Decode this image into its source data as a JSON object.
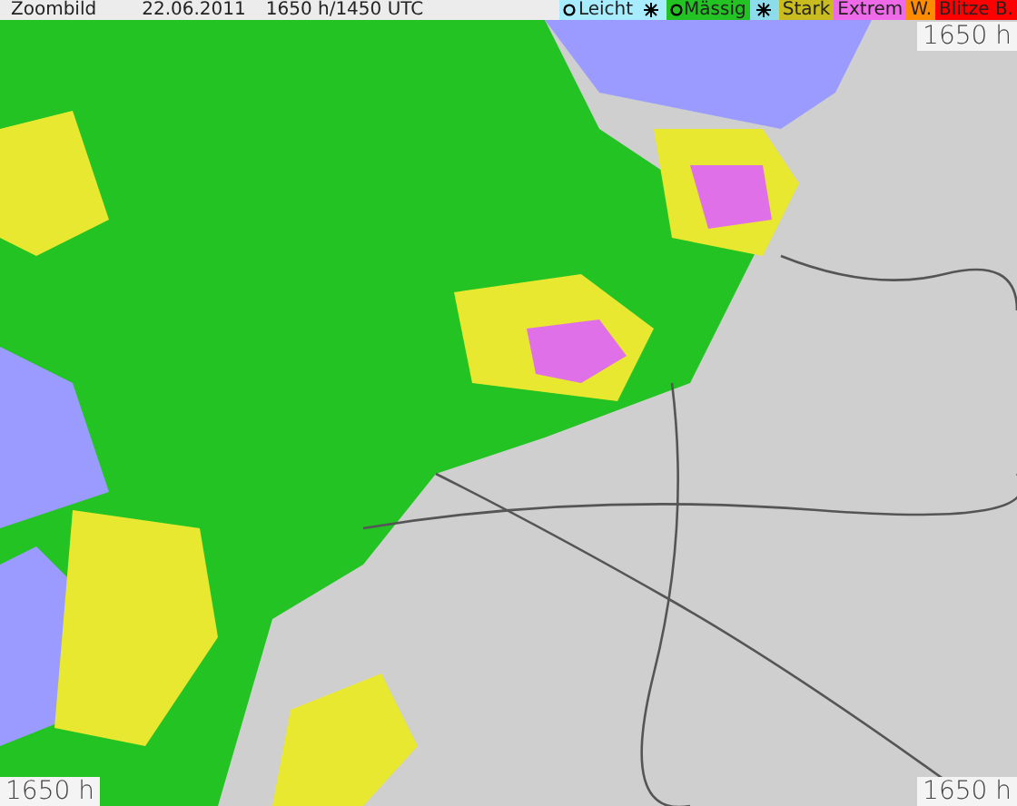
{
  "header": {
    "title": "Zoombild",
    "date": "22.06.2011",
    "time": "1650 h/1450 UTC"
  },
  "legend": [
    {
      "kind": "rain",
      "label": "Leicht",
      "color": "#a8ecff"
    },
    {
      "kind": "snow",
      "color": "#a8ecff"
    },
    {
      "kind": "rain",
      "label": "Mässig",
      "color": "#22c322"
    },
    {
      "kind": "snow",
      "color": "#8cdcec"
    },
    {
      "kind": "plain",
      "label": "Stark",
      "color": "#c8bc20"
    },
    {
      "kind": "plain",
      "label": "Extrem",
      "color": "#ee6ae8"
    },
    {
      "kind": "plain",
      "label": "W.",
      "color": "#ff8c00"
    },
    {
      "kind": "plain",
      "label": "Blitze B.",
      "color": "#ff0000"
    }
  ],
  "map_stamps": {
    "top_right": "1650 h",
    "bottom_left": "1650 h",
    "bottom_right": "1650 h"
  }
}
